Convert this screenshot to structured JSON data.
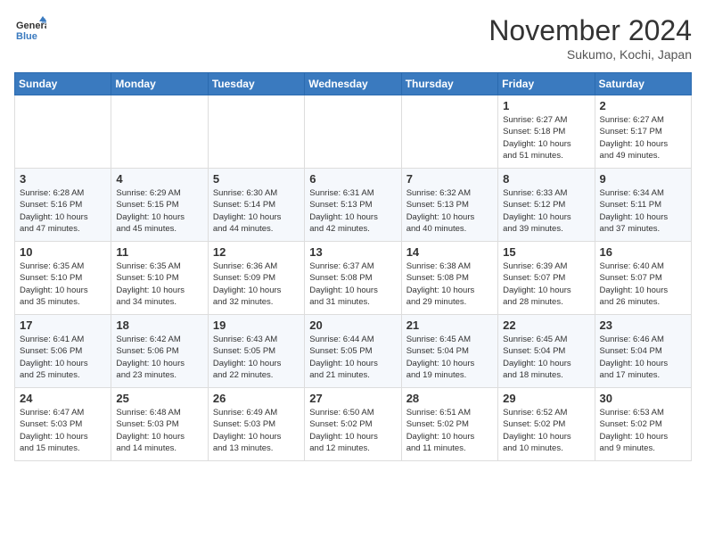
{
  "header": {
    "logo_line1": "General",
    "logo_line2": "Blue",
    "month": "November 2024",
    "location": "Sukumo, Kochi, Japan"
  },
  "days_of_week": [
    "Sunday",
    "Monday",
    "Tuesday",
    "Wednesday",
    "Thursday",
    "Friday",
    "Saturday"
  ],
  "weeks": [
    [
      {
        "day": "",
        "info": ""
      },
      {
        "day": "",
        "info": ""
      },
      {
        "day": "",
        "info": ""
      },
      {
        "day": "",
        "info": ""
      },
      {
        "day": "",
        "info": ""
      },
      {
        "day": "1",
        "info": "Sunrise: 6:27 AM\nSunset: 5:18 PM\nDaylight: 10 hours\nand 51 minutes."
      },
      {
        "day": "2",
        "info": "Sunrise: 6:27 AM\nSunset: 5:17 PM\nDaylight: 10 hours\nand 49 minutes."
      }
    ],
    [
      {
        "day": "3",
        "info": "Sunrise: 6:28 AM\nSunset: 5:16 PM\nDaylight: 10 hours\nand 47 minutes."
      },
      {
        "day": "4",
        "info": "Sunrise: 6:29 AM\nSunset: 5:15 PM\nDaylight: 10 hours\nand 45 minutes."
      },
      {
        "day": "5",
        "info": "Sunrise: 6:30 AM\nSunset: 5:14 PM\nDaylight: 10 hours\nand 44 minutes."
      },
      {
        "day": "6",
        "info": "Sunrise: 6:31 AM\nSunset: 5:13 PM\nDaylight: 10 hours\nand 42 minutes."
      },
      {
        "day": "7",
        "info": "Sunrise: 6:32 AM\nSunset: 5:13 PM\nDaylight: 10 hours\nand 40 minutes."
      },
      {
        "day": "8",
        "info": "Sunrise: 6:33 AM\nSunset: 5:12 PM\nDaylight: 10 hours\nand 39 minutes."
      },
      {
        "day": "9",
        "info": "Sunrise: 6:34 AM\nSunset: 5:11 PM\nDaylight: 10 hours\nand 37 minutes."
      }
    ],
    [
      {
        "day": "10",
        "info": "Sunrise: 6:35 AM\nSunset: 5:10 PM\nDaylight: 10 hours\nand 35 minutes."
      },
      {
        "day": "11",
        "info": "Sunrise: 6:35 AM\nSunset: 5:10 PM\nDaylight: 10 hours\nand 34 minutes."
      },
      {
        "day": "12",
        "info": "Sunrise: 6:36 AM\nSunset: 5:09 PM\nDaylight: 10 hours\nand 32 minutes."
      },
      {
        "day": "13",
        "info": "Sunrise: 6:37 AM\nSunset: 5:08 PM\nDaylight: 10 hours\nand 31 minutes."
      },
      {
        "day": "14",
        "info": "Sunrise: 6:38 AM\nSunset: 5:08 PM\nDaylight: 10 hours\nand 29 minutes."
      },
      {
        "day": "15",
        "info": "Sunrise: 6:39 AM\nSunset: 5:07 PM\nDaylight: 10 hours\nand 28 minutes."
      },
      {
        "day": "16",
        "info": "Sunrise: 6:40 AM\nSunset: 5:07 PM\nDaylight: 10 hours\nand 26 minutes."
      }
    ],
    [
      {
        "day": "17",
        "info": "Sunrise: 6:41 AM\nSunset: 5:06 PM\nDaylight: 10 hours\nand 25 minutes."
      },
      {
        "day": "18",
        "info": "Sunrise: 6:42 AM\nSunset: 5:06 PM\nDaylight: 10 hours\nand 23 minutes."
      },
      {
        "day": "19",
        "info": "Sunrise: 6:43 AM\nSunset: 5:05 PM\nDaylight: 10 hours\nand 22 minutes."
      },
      {
        "day": "20",
        "info": "Sunrise: 6:44 AM\nSunset: 5:05 PM\nDaylight: 10 hours\nand 21 minutes."
      },
      {
        "day": "21",
        "info": "Sunrise: 6:45 AM\nSunset: 5:04 PM\nDaylight: 10 hours\nand 19 minutes."
      },
      {
        "day": "22",
        "info": "Sunrise: 6:45 AM\nSunset: 5:04 PM\nDaylight: 10 hours\nand 18 minutes."
      },
      {
        "day": "23",
        "info": "Sunrise: 6:46 AM\nSunset: 5:04 PM\nDaylight: 10 hours\nand 17 minutes."
      }
    ],
    [
      {
        "day": "24",
        "info": "Sunrise: 6:47 AM\nSunset: 5:03 PM\nDaylight: 10 hours\nand 15 minutes."
      },
      {
        "day": "25",
        "info": "Sunrise: 6:48 AM\nSunset: 5:03 PM\nDaylight: 10 hours\nand 14 minutes."
      },
      {
        "day": "26",
        "info": "Sunrise: 6:49 AM\nSunset: 5:03 PM\nDaylight: 10 hours\nand 13 minutes."
      },
      {
        "day": "27",
        "info": "Sunrise: 6:50 AM\nSunset: 5:02 PM\nDaylight: 10 hours\nand 12 minutes."
      },
      {
        "day": "28",
        "info": "Sunrise: 6:51 AM\nSunset: 5:02 PM\nDaylight: 10 hours\nand 11 minutes."
      },
      {
        "day": "29",
        "info": "Sunrise: 6:52 AM\nSunset: 5:02 PM\nDaylight: 10 hours\nand 10 minutes."
      },
      {
        "day": "30",
        "info": "Sunrise: 6:53 AM\nSunset: 5:02 PM\nDaylight: 10 hours\nand 9 minutes."
      }
    ]
  ]
}
